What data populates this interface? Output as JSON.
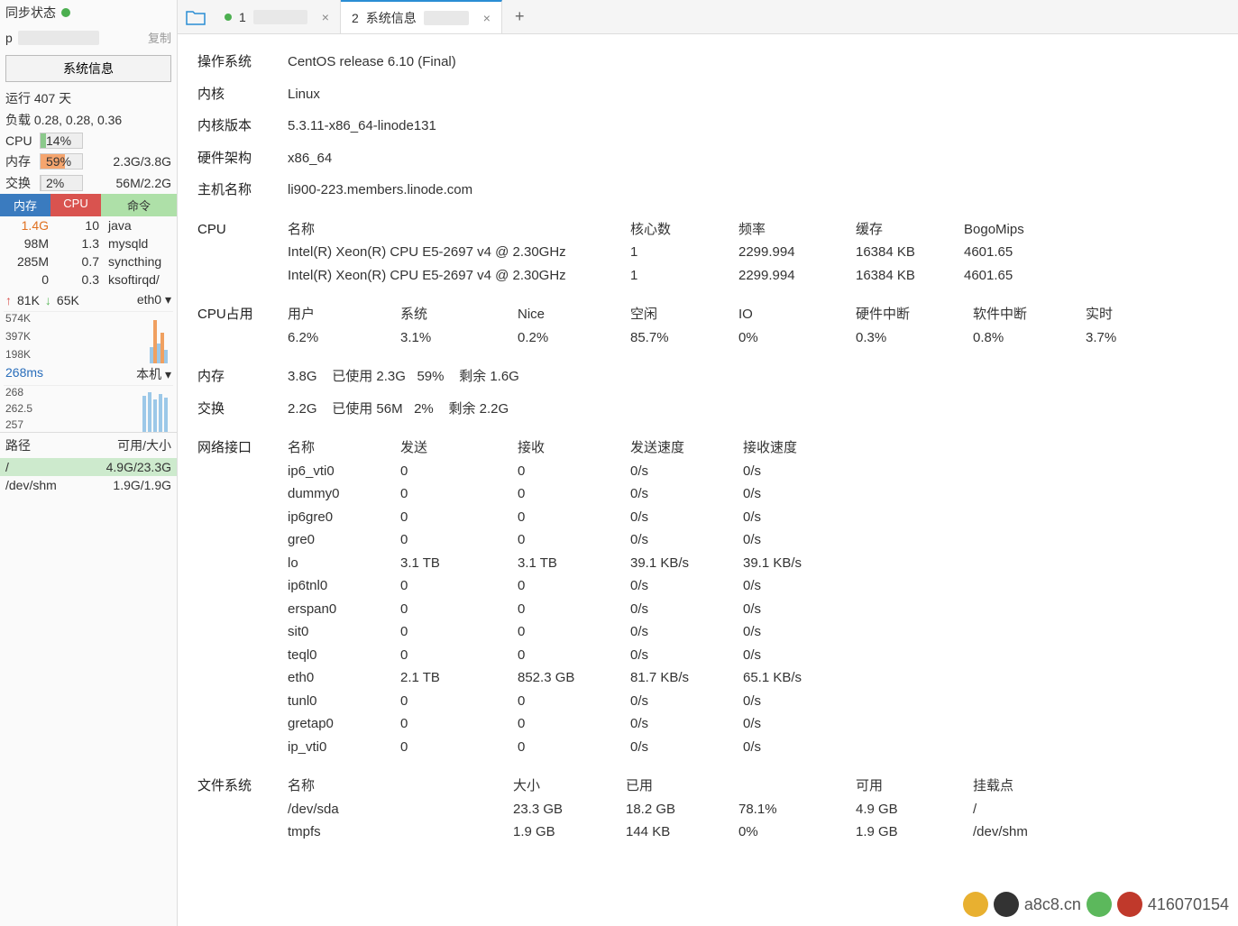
{
  "sidebar": {
    "sync_label": "同步状态",
    "ip_prefix": "p",
    "copy": "复制",
    "sysinfo_btn": "系统信息",
    "uptime_prefix": "运行",
    "uptime_days": "407",
    "uptime_suffix": "天",
    "load_label": "负载",
    "load": "0.28, 0.28, 0.36",
    "cpu_label": "CPU",
    "cpu_pct": "14%",
    "mem_label": "内存",
    "mem_pct": "59%",
    "mem_ratio": "2.3G/3.8G",
    "swap_label": "交换",
    "swap_pct": "2%",
    "swap_ratio": "56M/2.2G",
    "proc_headers": {
      "mem": "内存",
      "cpu": "CPU",
      "cmd": "命令"
    },
    "procs": [
      {
        "mem": "1.4G",
        "cpu": "10",
        "cmd": "java",
        "orange": true
      },
      {
        "mem": "98M",
        "cpu": "1.3",
        "cmd": "mysqld"
      },
      {
        "mem": "285M",
        "cpu": "0.7",
        "cmd": "syncthing"
      },
      {
        "mem": "0",
        "cpu": "0.3",
        "cmd": "ksoftirqd/"
      }
    ],
    "net_up": "81K",
    "net_dn": "65K",
    "iface": "eth0",
    "spark_y": [
      "574K",
      "397K",
      "198K"
    ],
    "ping_ms": "268ms",
    "ping_local": "本机",
    "ping_vals": [
      "268",
      "262.5",
      "257"
    ],
    "disk_h_path": "路径",
    "disk_h_size": "可用/大小",
    "disks": [
      {
        "path": "/",
        "size": "4.9G/23.3G",
        "hi": true
      },
      {
        "path": "/dev/shm",
        "size": "1.9G/1.9G"
      }
    ]
  },
  "tabs": {
    "t1_num": "1",
    "t2_num": "2",
    "t2_label": "系统信息"
  },
  "info": {
    "os_l": "操作系统",
    "os_v": "CentOS release 6.10 (Final)",
    "kernel_l": "内核",
    "kernel_v": "Linux",
    "kver_l": "内核版本",
    "kver_v": "5.3.11-x86_64-linode131",
    "arch_l": "硬件架构",
    "arch_v": "x86_64",
    "host_l": "主机名称",
    "host_v": "li900-223.members.linode.com"
  },
  "cpu": {
    "label": "CPU",
    "headers": {
      "name": "名称",
      "cores": "核心数",
      "freq": "频率",
      "cache": "缓存",
      "bogo": "BogoMips"
    },
    "rows": [
      {
        "name": "Intel(R) Xeon(R) CPU E5-2697 v4 @ 2.30GHz",
        "cores": "1",
        "freq": "2299.994",
        "cache": "16384 KB",
        "bogo": "4601.65"
      },
      {
        "name": "Intel(R) Xeon(R) CPU E5-2697 v4 @ 2.30GHz",
        "cores": "1",
        "freq": "2299.994",
        "cache": "16384 KB",
        "bogo": "4601.65"
      }
    ]
  },
  "cpuusage": {
    "label": "CPU占用",
    "cols": [
      {
        "h": "用户",
        "v": "6.2%"
      },
      {
        "h": "系统",
        "v": "3.1%"
      },
      {
        "h": "Nice",
        "v": "0.2%"
      },
      {
        "h": "空闲",
        "v": "85.7%"
      },
      {
        "h": "IO",
        "v": "0%"
      },
      {
        "h": "硬件中断",
        "v": "0.3%"
      },
      {
        "h": "软件中断",
        "v": "0.8%"
      },
      {
        "h": "实时",
        "v": "3.7%"
      }
    ]
  },
  "mem": {
    "label": "内存",
    "total": "3.8G",
    "used_l": "已使用",
    "used": "2.3G",
    "pct": "59%",
    "free_l": "剩余",
    "free": "1.6G"
  },
  "swap": {
    "label": "交换",
    "total": "2.2G",
    "used_l": "已使用",
    "used": "56M",
    "pct": "2%",
    "free_l": "剩余",
    "free": "2.2G"
  },
  "netif": {
    "label": "网络接口",
    "headers": {
      "name": "名称",
      "send": "发送",
      "recv": "接收",
      "sspd": "发送速度",
      "rspd": "接收速度"
    },
    "rows": [
      {
        "name": "ip6_vti0",
        "send": "0",
        "recv": "0",
        "sspd": "0/s",
        "rspd": "0/s"
      },
      {
        "name": "dummy0",
        "send": "0",
        "recv": "0",
        "sspd": "0/s",
        "rspd": "0/s"
      },
      {
        "name": "ip6gre0",
        "send": "0",
        "recv": "0",
        "sspd": "0/s",
        "rspd": "0/s"
      },
      {
        "name": "gre0",
        "send": "0",
        "recv": "0",
        "sspd": "0/s",
        "rspd": "0/s"
      },
      {
        "name": "lo",
        "send": "3.1 TB",
        "recv": "3.1 TB",
        "sspd": "39.1 KB/s",
        "rspd": "39.1 KB/s"
      },
      {
        "name": "ip6tnl0",
        "send": "0",
        "recv": "0",
        "sspd": "0/s",
        "rspd": "0/s"
      },
      {
        "name": "erspan0",
        "send": "0",
        "recv": "0",
        "sspd": "0/s",
        "rspd": "0/s"
      },
      {
        "name": "sit0",
        "send": "0",
        "recv": "0",
        "sspd": "0/s",
        "rspd": "0/s"
      },
      {
        "name": "teql0",
        "send": "0",
        "recv": "0",
        "sspd": "0/s",
        "rspd": "0/s"
      },
      {
        "name": "eth0",
        "send": "2.1 TB",
        "recv": "852.3 GB",
        "sspd": "81.7 KB/s",
        "rspd": "65.1 KB/s"
      },
      {
        "name": "tunl0",
        "send": "0",
        "recv": "0",
        "sspd": "0/s",
        "rspd": "0/s"
      },
      {
        "name": "gretap0",
        "send": "0",
        "recv": "0",
        "sspd": "0/s",
        "rspd": "0/s"
      },
      {
        "name": "ip_vti0",
        "send": "0",
        "recv": "0",
        "sspd": "0/s",
        "rspd": "0/s"
      }
    ]
  },
  "fs": {
    "label": "文件系统",
    "headers": {
      "name": "名称",
      "size": "大小",
      "used": "已用",
      "pct": "",
      "avail": "可用",
      "mount": "挂载点"
    },
    "rows": [
      {
        "name": "/dev/sda",
        "size": "23.3 GB",
        "used": "18.2 GB",
        "pct": "78.1%",
        "avail": "4.9 GB",
        "mount": "/"
      },
      {
        "name": "tmpfs",
        "size": "1.9 GB",
        "used": "144 KB",
        "pct": "0%",
        "avail": "1.9 GB",
        "mount": "/dev/shm"
      }
    ]
  },
  "watermark": {
    "site": "a8c8.cn",
    "qq": "416070154"
  }
}
